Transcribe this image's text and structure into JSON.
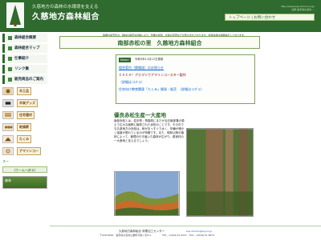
{
  "header": {
    "tagline": "久慈地方の森林の水環境を支える",
    "title": "久慈地方森林組合",
    "right_small": [
      "http://www.kuji-shinrin.or.jp/",
      "住所 岩手県久慈市 ..."
    ],
    "right_box": "トップページ | お問い合わせ"
  },
  "sidebar": {
    "items": [
      {
        "label": "森林組合概要"
      },
      {
        "label": "森林組合マップ"
      },
      {
        "label": "仕事紹介"
      },
      {
        "label": "リンク集"
      },
      {
        "label": "販売商品のご案内"
      }
    ],
    "products": [
      {
        "label": "木工品"
      },
      {
        "label": "木炭グッズ"
      },
      {
        "label": "住宅建材"
      },
      {
        "label": "乾燥薪"
      },
      {
        "label": "たくみ"
      },
      {
        "label": "アマリンコー"
      }
    ],
    "sub_link": "スー",
    "sub_button": "(ホームへ戻る)",
    "banner_text": "森林"
  },
  "main": {
    "note": "事業計画予定は、森林の病害虫対策により、作業の遅延、計画の変更などが見込まれております。最新情報は随時掲示しております。",
    "title": "南部赤松の里　久慈地方森林組合",
    "news": {
      "badge": "News!",
      "date": "令和3年11月12日更新",
      "line1": "組合案内（情報誌）のお知らせ",
      "line2": "ＣＡＣＡ！アカマツでアマリンコースター製作",
      "line3": "（詳細はコチラ）",
      "line4": "住宅向け教育関連「たくみ」開発・販売　（詳細はコチラ）"
    },
    "section_title": "優良赤松生産一大産地",
    "section_text": "南部赤松とは、岩手県・青森県にまたがる旧南部藩の領土で広大な面積に植林された赤松のことです。その中でも久慈地方の赤松は、幹がまっすぐで太く、年輪が細かく強度が優れているのが特徴です。また、昭和以降の植林によって、管理の行き届いた森林が広がり、優良材の一大産地と言えるでしょう。"
  },
  "footer": {
    "org": "久慈地方森林組合 林業加工センター",
    "address": "〒028-8000　岩手県久慈市山根町字前ノ沢2-2",
    "email": "kuji-shinrin@kuji.or.jp",
    "phone": "TEL：(0194)72-2227　FAX：(0194)72-3874"
  },
  "colors": {
    "brand": "#2f6a2e",
    "panel": "#f4f7e9"
  }
}
